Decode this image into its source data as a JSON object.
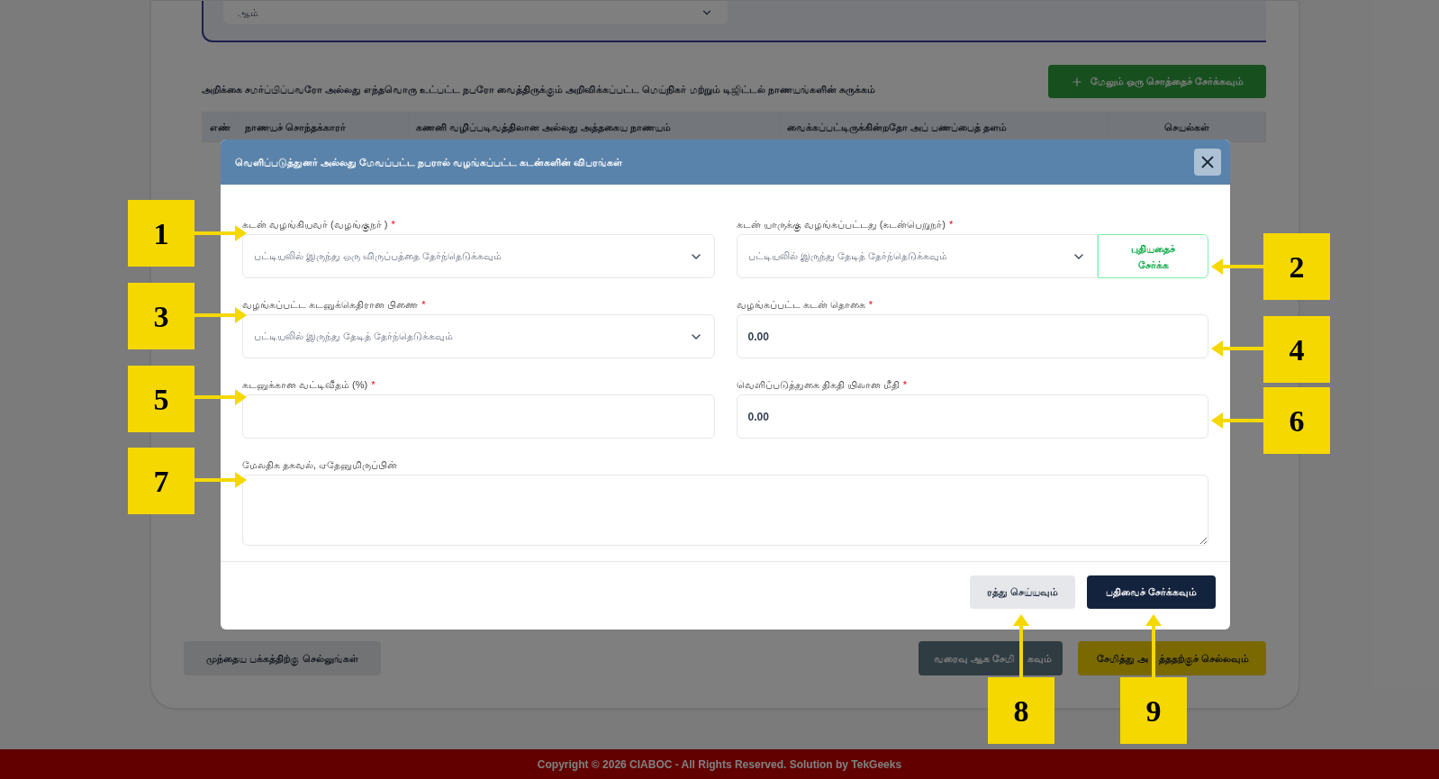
{
  "background_page": {
    "top_select": {
      "value": "ஆம்"
    },
    "assets_heading": "அறிக்கை சமர்ப்பிப்பவரோ அல்லது எந்தவொரு உட்பட்ட நபரோ வைத்திருக்கும் அறிவிக்கப்பட்ட மெய்நிகர் மற்றும் டிஜிட்டல் நாணயங்களின் சுருக்கம்",
    "add_asset_button": "மேலும் ஒரு சொத்தைச் சேர்க்கவும்",
    "table": {
      "columns": [
        "எண்",
        "நாணயச் சொந்தக்காரர்",
        "கணனி வழிப்படிவத்திலான அல்லது அத்தகைய நாணயம்",
        "வைக்கப்பட்டிருக்கின்றதோ அப் பணப்பைத் தளம்",
        "செயல்கள்"
      ]
    },
    "previous_button": "முந்தைய பக்கத்திற்கு செல்லுங்கள்",
    "draft_button": [
      "வரைவு ஆக சேமி",
      "கவும்"
    ],
    "next_button": [
      "சேமித்து அ",
      "த்ததற்குச் செல்லவும்"
    ]
  },
  "modal": {
    "title": "வெளிப்படுத்துனர் அல்லது மேவப்பட்ட நபரால் வழங்கப்பட்ட கடன்களின் விபரங்கள்",
    "fields": [
      {
        "kind": "select",
        "label": "கடன் வழங்கியவர் (வழங்குநர் )",
        "required_mark": "*",
        "placeholder": "பட்டியலில் இருந்து ஒரு விருப்பத்தை தேர்ந்தெடுக்கவும்"
      },
      {
        "kind": "select",
        "label": "கடன் யாருக்கு வழங்கப்பட்டது (கடன்பெறுநர்)",
        "required_mark": "*",
        "placeholder": "பட்டியலில் இருந்து தேடித் தேர்ந்தெடுக்கவும்",
        "add_button": "புதியதைச் சேர்க்க"
      },
      {
        "kind": "select",
        "label": "வழங்கப்பட்ட கடனுக்கெதிரான பிணை",
        "required_mark": "*",
        "placeholder": "பட்டியலில் இருந்து தேடித் தேர்ந்தெடுக்கவும்"
      },
      {
        "kind": "input",
        "label": "வழங்கப்பட்ட கடன் தொகை",
        "required_mark": "*",
        "value": "0.00"
      },
      {
        "kind": "input",
        "label": "கடனுக்கான வட்டிவீதம் (%)",
        "required_mark": "*"
      },
      {
        "kind": "input",
        "label": "வெளிப்படுத்துகை திகதி யிலான மீதி",
        "required_mark": "*",
        "value": "0.00"
      }
    ],
    "notes": {
      "label": "மேலதிக தகவல், ஏதேனுமிருப்பின்"
    },
    "cancel_button": "ரத்து செய்யவும்",
    "save_button": "பதிவைச் சேர்க்கவும்"
  },
  "footer": "Copyright © 2026 CIABOC - All Rights Reserved. Solution by TekGeeks",
  "callouts": [
    {
      "number": "1"
    },
    {
      "number": "2"
    },
    {
      "number": "3"
    },
    {
      "number": "4"
    },
    {
      "number": "5"
    },
    {
      "number": "6"
    },
    {
      "number": "7"
    },
    {
      "number": "8"
    },
    {
      "number": "9"
    }
  ]
}
